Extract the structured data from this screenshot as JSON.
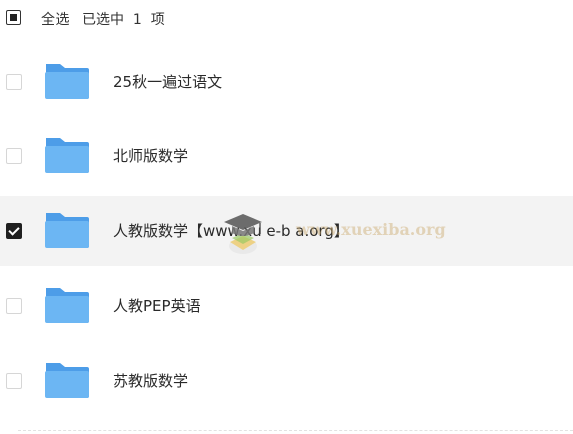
{
  "header": {
    "select_all_label": "全选",
    "selected_info": "已选中  1  项"
  },
  "files": [
    {
      "name": "25秋一遍过语文",
      "type": "folder",
      "checked": false
    },
    {
      "name": "北师版数学",
      "type": "folder",
      "checked": false
    },
    {
      "name": "人教版数学【www.xu e-b a.org】",
      "type": "folder",
      "checked": true
    },
    {
      "name": "人教PEP英语",
      "type": "folder",
      "checked": false
    },
    {
      "name": "苏教版数学",
      "type": "folder",
      "checked": false
    }
  ],
  "watermark": {
    "text": "www.xuexiba.org",
    "icon": "graduation-cap-icon"
  },
  "colors": {
    "folder": "#5aa9ef",
    "selected_row_bg": "#f3f3f3",
    "checked_box": "#1f1f1f"
  }
}
